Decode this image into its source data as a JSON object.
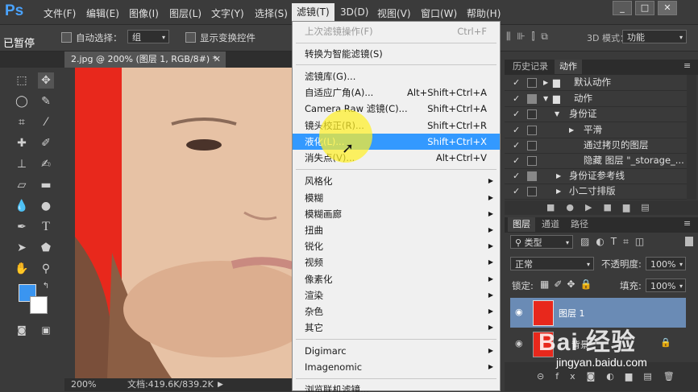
{
  "menubar": {
    "logo": "Ps",
    "items": [
      "文件(F)",
      "编辑(E)",
      "图像(I)",
      "图层(L)",
      "文字(Y)",
      "选择(S)",
      "滤镜(T)",
      "3D(D)",
      "视图(V)",
      "窗口(W)",
      "帮助(H)"
    ],
    "active_item": "滤镜(T)",
    "window_buttons": [
      "_",
      "□",
      "✕"
    ]
  },
  "overlay": {
    "paused_label": "已暂停"
  },
  "options_bar": {
    "auto_select_label": "自动选择：",
    "auto_select_value": "组",
    "show_transform_label": "显示变换控件",
    "mode_3d_label": "3D 模式：",
    "mode_3d_value": "功能"
  },
  "document": {
    "tab_title": "2.jpg @ 200% (图层 1, RGB/8#) *",
    "zoom": "200%",
    "doc_info": "文档:419.6K/839.2K"
  },
  "filter_menu": {
    "items": [
      {
        "label": "上次滤镜操作(F)",
        "shortcut": "Ctrl+F",
        "disabled": true
      },
      {
        "sep": true
      },
      {
        "label": "转换为智能滤镜(S)"
      },
      {
        "sep": true
      },
      {
        "label": "滤镜库(G)..."
      },
      {
        "label": "自适应广角(A)...",
        "shortcut": "Alt+Shift+Ctrl+A"
      },
      {
        "label": "Camera Raw 滤镜(C)...",
        "shortcut": "Shift+Ctrl+A"
      },
      {
        "label": "镜头校正(R)...",
        "shortcut": "Shift+Ctrl+R"
      },
      {
        "label": "液化(L)...",
        "shortcut": "Shift+Ctrl+X",
        "highlighted": true
      },
      {
        "label": "消失点(V)...",
        "shortcut": "Alt+Ctrl+V"
      },
      {
        "sep": true
      },
      {
        "label": "风格化",
        "submenu": true
      },
      {
        "label": "模糊",
        "submenu": true
      },
      {
        "label": "模糊画廊",
        "submenu": true
      },
      {
        "label": "扭曲",
        "submenu": true
      },
      {
        "label": "锐化",
        "submenu": true
      },
      {
        "label": "视频",
        "submenu": true
      },
      {
        "label": "像素化",
        "submenu": true
      },
      {
        "label": "渲染",
        "submenu": true
      },
      {
        "label": "杂色",
        "submenu": true
      },
      {
        "label": "其它",
        "submenu": true
      },
      {
        "sep": true
      },
      {
        "label": "Digimarc",
        "submenu": true
      },
      {
        "label": "Imagenomic",
        "submenu": true
      },
      {
        "sep": true
      },
      {
        "label": "浏览联机滤镜..."
      }
    ]
  },
  "actions_panel": {
    "tabs": [
      "历史记录",
      "动作"
    ],
    "active_tab": "动作",
    "rows": [
      {
        "label": "默认动作",
        "type": "set"
      },
      {
        "label": "动作",
        "type": "set-open"
      },
      {
        "label": "身份证",
        "type": "action-open"
      },
      {
        "label": "平滑",
        "type": "step"
      },
      {
        "label": "通过拷贝的图层",
        "type": "substep"
      },
      {
        "label": "隐藏 图层 \"_storage_...",
        "type": "substep"
      },
      {
        "label": "身份证参考线",
        "type": "action"
      },
      {
        "label": "小二寸排版",
        "type": "action"
      }
    ]
  },
  "layers_panel": {
    "tabs": [
      "图层",
      "通道",
      "路径"
    ],
    "active_tab": "图层",
    "filter_kind": "类型",
    "blend_mode": "正常",
    "opacity_label": "不透明度:",
    "opacity_value": "100%",
    "lock_label": "锁定:",
    "fill_label": "填充:",
    "fill_value": "100%",
    "layers": [
      {
        "name": "图层 1",
        "selected": true
      },
      {
        "name": "背景",
        "locked": true
      }
    ]
  },
  "watermark": {
    "text": "Bai 经验",
    "url": "jingyan.baidu.com"
  },
  "colors": {
    "accent": "#3399ff",
    "menu_bg": "#f0f0f0",
    "ui_dark": "#3a3a3a",
    "canvas_red": "#e8281c"
  }
}
